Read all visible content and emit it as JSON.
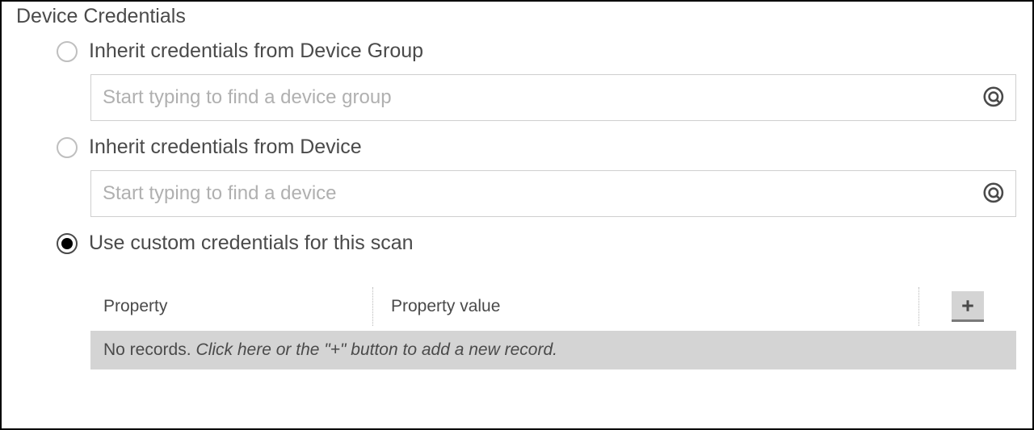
{
  "section_title": "Device Credentials",
  "options": {
    "inherit_group": {
      "label": "Inherit credentials from Device Group",
      "placeholder": "Start typing to find a device group",
      "selected": false
    },
    "inherit_device": {
      "label": "Inherit credentials from Device",
      "placeholder": "Start typing to find a device",
      "selected": false
    },
    "custom": {
      "label": "Use custom credentials for this scan",
      "selected": true
    }
  },
  "table": {
    "columns": {
      "property": "Property",
      "value": "Property value"
    },
    "empty_prefix": "No records.",
    "empty_hint": "Click here or the \"+\" button to add a new record."
  }
}
